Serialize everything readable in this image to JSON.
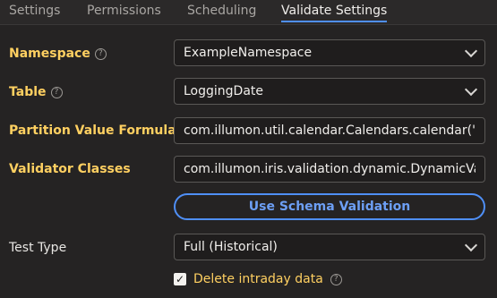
{
  "tabs": [
    {
      "label": "Settings"
    },
    {
      "label": "Permissions"
    },
    {
      "label": "Scheduling"
    },
    {
      "label": "Validate Settings",
      "active": true
    }
  ],
  "form": {
    "namespace": {
      "label": "Namespace",
      "value": "ExampleNamespace",
      "has_help": true
    },
    "table": {
      "label": "Table",
      "value": "LoggingDate",
      "has_help": true
    },
    "partition": {
      "label": "Partition Value Formula",
      "value": "com.illumon.util.calendar.Calendars.calendar(\"USNYSE\")",
      "has_help": true
    },
    "validator": {
      "label": "Validator Classes",
      "value": "com.illumon.iris.validation.dynamic.DynamicValidator",
      "has_help": false
    },
    "schema_button": "Use Schema Validation",
    "test_type": {
      "label": "Test Type",
      "value": "Full (Historical)"
    },
    "delete_intraday": {
      "label": "Delete intraday data",
      "checked": true
    }
  },
  "icons": {
    "help": "help-circle-icon",
    "chevron": "chevron-down-icon",
    "check": "checkmark-icon"
  },
  "colors": {
    "background": "#252323",
    "label_accent": "#ffd061",
    "primary": "#4f8ff7"
  }
}
